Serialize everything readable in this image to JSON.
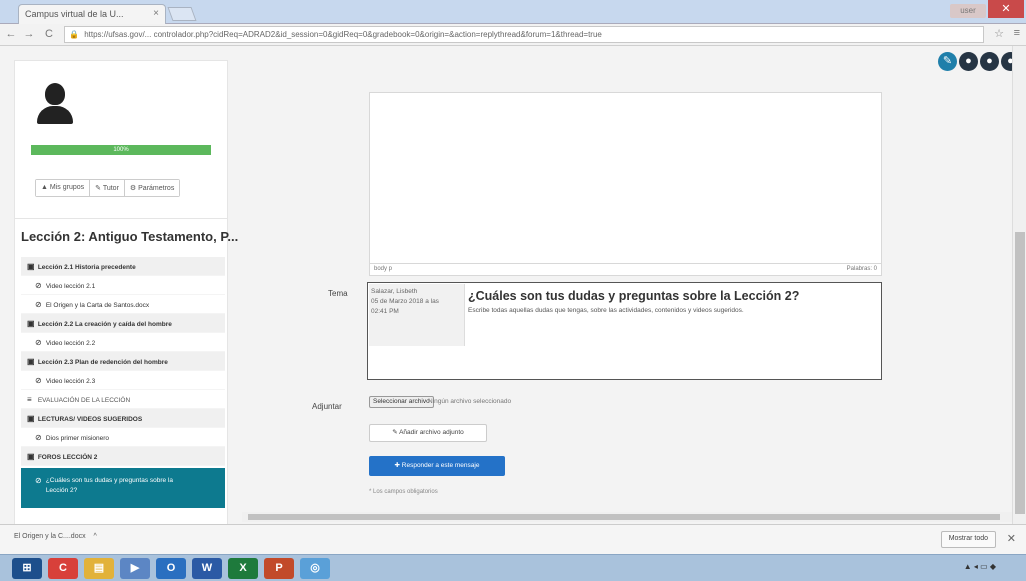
{
  "browser": {
    "tab_title": "Campus virtual de la U...",
    "tab_close": "×",
    "url": "https://ufsas.gov/... controlador.php?cidReq=ADRAD2&id_session=0&gidReq=0&gradebook=0&origin=&action=replythread&forum=1&thread=true",
    "back": "←",
    "forward": "→",
    "reload": "C",
    "lock": "🔒",
    "star": "☆",
    "menu": "≡",
    "user_badge": "user",
    "window_close": "✕"
  },
  "top_icons": [
    "✎",
    "●",
    "●",
    "●"
  ],
  "profile": {
    "progress": {
      "percent": 100,
      "label": "100%"
    },
    "buttons": [
      {
        "icon": "▲",
        "label": "Mis grupos"
      },
      {
        "icon": "✎",
        "label": "Tutor"
      },
      {
        "icon": "⚙",
        "label": "Parámetros"
      }
    ]
  },
  "lesson": {
    "title": "Lección 2: Antiguo Testamento, P...",
    "items": [
      {
        "kind": "section",
        "icon": "▣",
        "label": "Lección 2.1 Historia precedente"
      },
      {
        "kind": "sub",
        "icon": "⊘",
        "label": "Video lección 2.1"
      },
      {
        "kind": "sub",
        "icon": "⊘",
        "label": "El Origen y la Carta de Santos.docx"
      },
      {
        "kind": "section",
        "icon": "▣",
        "label": "Lección 2.2 La creación y caída del hombre"
      },
      {
        "kind": "sub",
        "icon": "⊘",
        "label": "Video lección 2.2"
      },
      {
        "kind": "section",
        "icon": "▣",
        "label": "Lección 2.3 Plan de redención del hombre"
      },
      {
        "kind": "sub",
        "icon": "⊘",
        "label": "Video lección 2.3"
      },
      {
        "kind": "plain",
        "icon": "≡",
        "label": "EVALUACIÓN DE LA LECCIÓN"
      },
      {
        "kind": "section",
        "icon": "▣",
        "label": "LECTURAS/ VIDEOS SUGERIDOS"
      },
      {
        "kind": "sub",
        "icon": "⊘",
        "label": "Dios primer misionero"
      },
      {
        "kind": "section",
        "icon": "▣",
        "label": "FOROS LECCIÓN 2"
      },
      {
        "kind": "active",
        "icon": "⊘",
        "label": "¿Cuáles son tus dudas y preguntas sobre la Lección 2?"
      }
    ]
  },
  "editor": {
    "status_left": "body p",
    "status_right": "Palabras: 0"
  },
  "form": {
    "tema_label": "Tema",
    "tema_meta": "Salazar, Lisbeth\n05 de Marzo 2018 a las\n02:41 PM",
    "tema_title": "¿Cuáles son tus dudas y preguntas sobre la Lección 2?",
    "tema_desc": "Escribe todas aquellas dudas que tengas, sobre las actividades, contenidos y videos sugeridos.",
    "adjuntar_label": "Adjuntar",
    "file_button": "Seleccionar archivo",
    "file_status": "Ningún archivo seleccionado",
    "attach_button": "✎ Añadir archivo adjunto",
    "submit_button": "✚ Responder a este mensaje",
    "required_note": "* Los campos obligatorios"
  },
  "download": {
    "item": "El Origen y la C....docx",
    "caret": "^",
    "show_all": "Mostrar todo",
    "close": "✕"
  },
  "taskbar": {
    "apps": [
      {
        "icon": "⊞",
        "color": "#1d4f8c"
      },
      {
        "icon": "C",
        "color": "#d8403a"
      },
      {
        "icon": "▤",
        "color": "#e2b23a"
      },
      {
        "icon": "▶",
        "color": "#5c86c4"
      },
      {
        "icon": "O",
        "color": "#2a6fc0"
      },
      {
        "icon": "W",
        "color": "#2b5aa5"
      },
      {
        "icon": "X",
        "color": "#1e7a3c"
      },
      {
        "icon": "P",
        "color": "#c24a2a"
      },
      {
        "icon": "◎",
        "color": "#5aa0d8"
      }
    ],
    "tray": "▲ ◂ ▭ ◆"
  }
}
